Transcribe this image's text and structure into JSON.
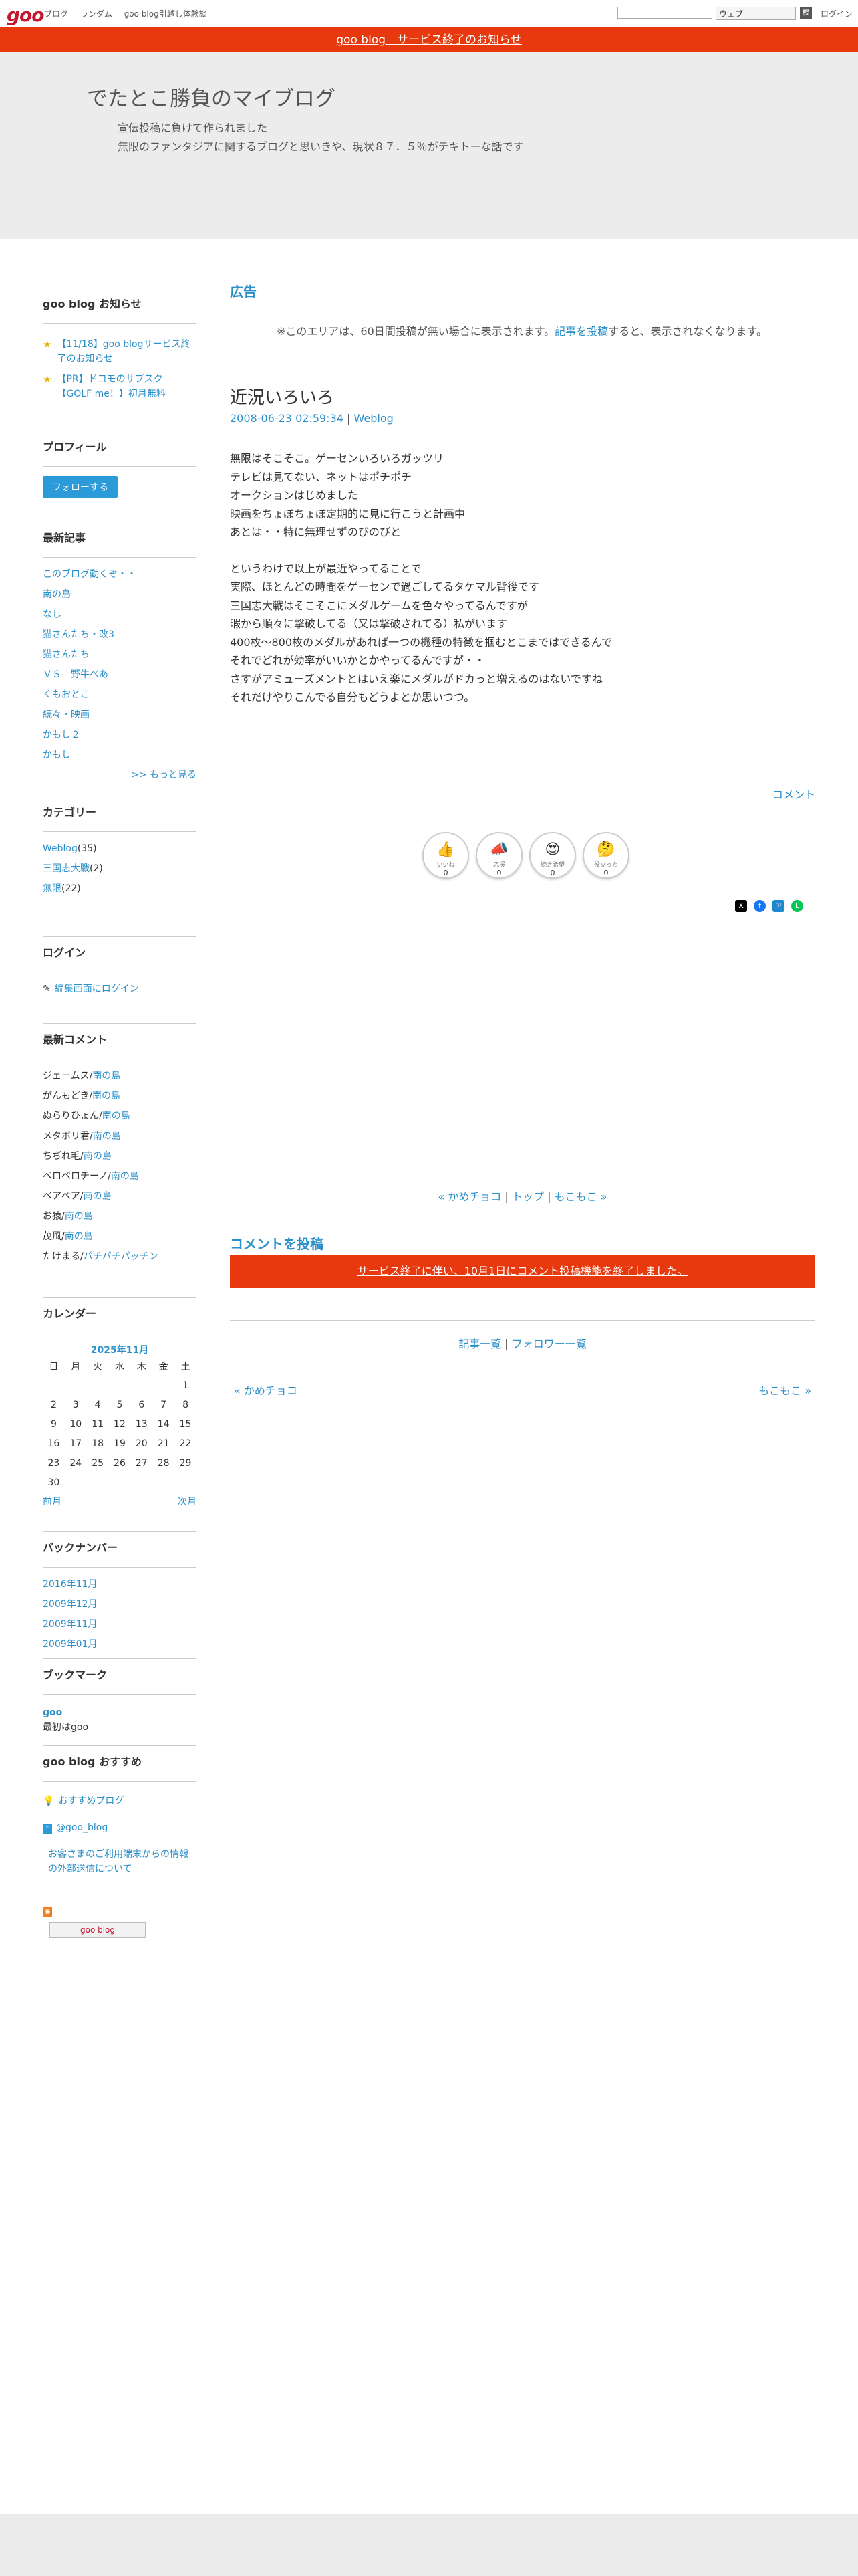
{
  "topbar": {
    "logo": "goo",
    "links": [
      "ブログ",
      "ランダム",
      "goo blog引越し体験談"
    ],
    "search_select": "ウェブ",
    "search_button": "検",
    "login": "ログイン"
  },
  "notice": {
    "text": "goo blog　サービス終了のお知らせ"
  },
  "header": {
    "title": "でたとこ勝負のマイブログ",
    "desc_line1": "宣伝投稿に負けて作られました",
    "desc_line2": "無限のファンタジアに関するブログと思いきや、現状８７．５％がテキトーな話です"
  },
  "sidebar": {
    "notice_title": "goo blog お知らせ",
    "notices": [
      "【11/18】goo blogサービス終了のお知らせ",
      "【PR】ドコモのサブスク【GOLF me！】初月無料"
    ],
    "profile_title": "プロフィール",
    "follow_button": "フォローする",
    "recent_title": "最新記事",
    "recent": [
      "このブログ動くぞ・・",
      "南の島",
      "なし",
      "猫さんたち・改3",
      "猫さんたち",
      "ＶＳ　野牛べあ",
      "くもおとこ",
      "続々・映画",
      "かもし２",
      "かもし"
    ],
    "more": ">> もっと見る",
    "category_title": "カテゴリー",
    "categories": [
      {
        "name": "Weblog",
        "count": "(35)"
      },
      {
        "name": "三国志大戦",
        "count": "(2)"
      },
      {
        "name": "無限",
        "count": "(22)"
      }
    ],
    "login_title": "ログイン",
    "login_link": "編集画面にログイン",
    "comments_title": "最新コメント",
    "comments": [
      {
        "user": "ジェームス",
        "post": "南の島"
      },
      {
        "user": "がんもどき",
        "post": "南の島"
      },
      {
        "user": "ぬらりひょん",
        "post": "南の島"
      },
      {
        "user": "メタボリ君",
        "post": "南の島"
      },
      {
        "user": "ちぢれ毛",
        "post": "南の島"
      },
      {
        "user": "ペロペロチーノ",
        "post": "南の島"
      },
      {
        "user": "ベアベア",
        "post": "南の島"
      },
      {
        "user": "お猿",
        "post": "南の島"
      },
      {
        "user": "茂風",
        "post": "南の島"
      },
      {
        "user": "たけまる",
        "post": "パチパチパッチン"
      }
    ],
    "calendar_title": "カレンダー",
    "calendar": {
      "month": "2025年11月",
      "weekdays": [
        "日",
        "月",
        "火",
        "水",
        "木",
        "金",
        "土"
      ],
      "weeks": [
        [
          "",
          "",
          "",
          "",
          "",
          "",
          "1"
        ],
        [
          "2",
          "3",
          "4",
          "5",
          "6",
          "7",
          "8"
        ],
        [
          "9",
          "10",
          "11",
          "12",
          "13",
          "14",
          "15"
        ],
        [
          "16",
          "17",
          "18",
          "19",
          "20",
          "21",
          "22"
        ],
        [
          "23",
          "24",
          "25",
          "26",
          "27",
          "28",
          "29"
        ],
        [
          "30",
          "",
          "",
          "",
          "",
          "",
          ""
        ]
      ],
      "prev": "前月",
      "next": "次月"
    },
    "backnumber_title": "バックナンバー",
    "backnumbers": [
      "2016年11月",
      "2009年12月",
      "2009年11月",
      "2009年01月"
    ],
    "bookmark_title": "ブックマーク",
    "bookmark_link": "goo",
    "bookmark_desc": "最初はgoo",
    "recommend_title": "goo blog おすすめ",
    "recommend_link1": "おすすめブログ",
    "recommend_link2": "@goo_blog",
    "recommend_link3": "お客さまのご利用端末からの情報の外部送信について",
    "badge": "goo blog"
  },
  "main": {
    "ad_title": "広告",
    "ad_note_pre": "※このエリアは、60日間投稿が無い場合に表示されます。",
    "ad_note_link": "記事を投稿",
    "ad_note_post": "すると、表示されなくなります。",
    "entry_title": "近況いろいろ",
    "entry_date": "2008-06-23 02:59:34",
    "entry_sep": "|",
    "entry_category": "Weblog",
    "body_p1": [
      "無限はそこそこ。ゲーセンいろいろガッツリ",
      "テレビは見てない、ネットはポチポチ",
      "オークションはじめました",
      "映画をちょぼちょぼ定期的に見に行こうと計画中",
      "あとは・・特に無理せずのびのびと"
    ],
    "body_p2": [
      "というわけで以上が最近やってることで",
      "実際、ほとんどの時間をゲーセンで過ごしてるタケマル背後です",
      "三国志大戦はそこそこにメダルゲームを色々やってるんですが",
      "暇から順々に撃破してる（又は撃破されてる）私がいます",
      "400枚〜800枚のメダルがあれば一つの機種の特徴を掴むとこまではできるんで",
      "それでどれが効率がいいかとかやってるんですが・・",
      "さすがアミューズメントとはいえ楽にメダルがドカっと増えるのはないですね",
      "それだけやりこんでる自分もどうよとか思いつつ。"
    ],
    "comment_link": "コメント",
    "reactions": [
      {
        "icon": "👍",
        "label": "いいね",
        "count": "0"
      },
      {
        "icon": "📣",
        "label": "応援",
        "count": "0"
      },
      {
        "icon": "😍",
        "label": "続き希望",
        "count": "0"
      },
      {
        "icon": "🤔",
        "label": "役立った",
        "count": "0"
      }
    ],
    "share": [
      "X",
      "f",
      "B!",
      "L"
    ],
    "pager_prev": "« かめチョコ",
    "pager_top": "トップ",
    "pager_next": "もこもこ »",
    "comment_post_title": "コメントを投稿",
    "closed_text": "サービス終了に伴い、10月1日にコメント投稿機能を終了しました。",
    "list_link1": "記事一覧",
    "list_link2": "フォロワー一覧",
    "bottom_prev": "« かめチョコ",
    "bottom_next": "もこもこ »"
  }
}
